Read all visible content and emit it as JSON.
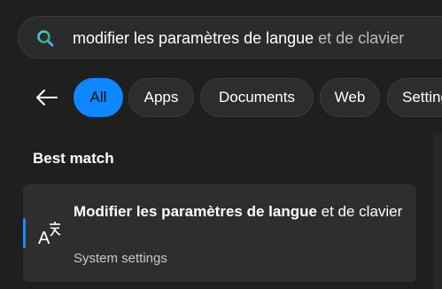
{
  "search": {
    "typed": "modifier les paramètres de langue",
    "suggestion": " et de clavier"
  },
  "filters": {
    "all": "All",
    "apps": "Apps",
    "documents": "Documents",
    "web": "Web",
    "settings": "Settings"
  },
  "best_match": {
    "section_title": "Best match",
    "title_bold": "Modifier les paramètres de langue",
    "title_rest": " et de clavier",
    "subtitle": "System settings",
    "icon": "language-icon"
  },
  "colors": {
    "accent": "#0f87ff",
    "background": "#1f1f1f",
    "card": "#2e2e2e"
  }
}
